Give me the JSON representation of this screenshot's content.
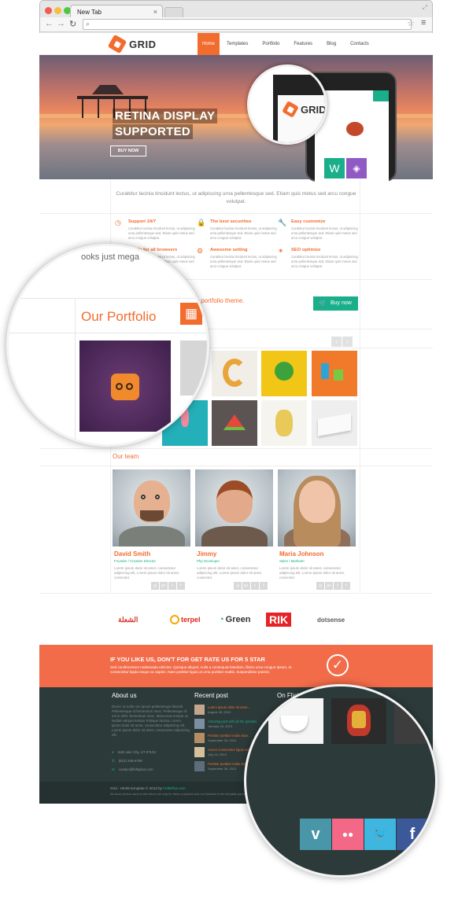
{
  "browser": {
    "tab_label": "New Tab",
    "tab_close": "×",
    "back_icon": "arrow-left-icon",
    "forward_icon": "arrow-right-icon",
    "reload_icon": "reload-icon",
    "search_icon": "search-icon",
    "star_icon": "star-icon",
    "menu_icon": "hamburger-menu-icon",
    "window_buttons": [
      "#ee5c54",
      "#f4be3f",
      "#4ec83e"
    ]
  },
  "nav": {
    "logo_text": "GRID",
    "items": [
      "Home",
      "Templates",
      "Portfolio",
      "Features",
      "Blog",
      "Contacts"
    ],
    "active": "Home"
  },
  "hero": {
    "title_line1": "RETINA DISPLAY",
    "title_line2": "SUPPORTED",
    "button": "BUY NOW"
  },
  "intro": {
    "text": "Curabitur lacinia tincidunt lectus, ut adipiscing urna pellentesque sed. Etiam quis metus sed arcu congue volutpat."
  },
  "features": [
    {
      "title": "Support 24/7",
      "icon": "clock-icon",
      "desc": "Curabitur lacinia tincidunt lectus, ut adipiscing urna pellentesque sed. Etiam quis metus sed arcu congue volutpat."
    },
    {
      "title": "The best securities",
      "icon": "lock-icon",
      "desc": "Curabitur lacinia tincidunt lectus, ut adipiscing urna pellentesque sed. Etiam quis metus sed arcu congue volutpat."
    },
    {
      "title": "Easy customize",
      "icon": "wrench-icon",
      "desc": "Curabitur lacinia tincidunt lectus, ut adipiscing urna pellentesque sed. Etiam quis metus sed arcu congue volutpat."
    },
    {
      "title": "Ready for all browsers",
      "icon": "thumbs-up-icon",
      "desc": "Curabitur lacinia tincidunt lectus, ut adipiscing urna pellentesque sed. Etiam quis metus sed arcu congue volutpat."
    },
    {
      "title": "Awesome setting",
      "icon": "gear-icon",
      "desc": "Curabitur lacinia tincidunt lectus, ut adipiscing urna pellentesque sed. Etiam quis metus sed arcu congue volutpat."
    },
    {
      "title": "SEO optimize",
      "icon": "magic-wand-icon",
      "desc": "Curabitur lacinia tincidunt lectus, ut adipiscing urna pellentesque sed. Etiam quis metus sed arcu congue volutpat."
    }
  ],
  "cta": {
    "left_fragment": "ooks just mega",
    "text": "reative portfolio theme.",
    "button": "Buy now",
    "cart_icon": "cart-icon"
  },
  "portfolio": {
    "title": "Our Portfolio",
    "grid_icon": "grid-icon",
    "prev": "‹",
    "next": "›"
  },
  "team": {
    "title": "Our team",
    "members": [
      {
        "name": "David Smith",
        "role": "Founder / Creative Director",
        "desc": "Lorem ipsum dolor sit amet, consectetur adipiscing elit. Lorem ipsum dolor sit amet, consectet."
      },
      {
        "name": "Jimmy",
        "role": "Php Developer",
        "desc": "Lorem ipsum dolor sit amet, consectetur adipiscing elit. Lorem ipsum dolor sit amet, consectet."
      },
      {
        "name": "Maria Johnson",
        "role": "Sales / Marketer",
        "desc": "Lorem ipsum dolor sit amet, consectetur adipiscing elit. Lorem ipsum dolor sit amet, consectet."
      }
    ],
    "social_icons": [
      "dribbble-icon",
      "google-plus-icon",
      "twitter-icon",
      "facebook-icon"
    ],
    "social_glyphs": [
      "◎",
      "g+",
      "t",
      "f"
    ]
  },
  "clients": [
    "Green",
    "RIK",
    "terpel",
    "dotsense",
    "الشعلة"
  ],
  "rate": {
    "title": "IF YOU LIKE US, DON'T FOR GET RATE US FOR 5 STAR",
    "desc": "Sed condimentum malesuada ultricies. Quisque aliquet, nulla a consequat interdum, libero urna congue ipsum, et consectetur ligula neque ac sapien. Nam porttitor ligula at urna porttitor mattis. Suspendisse potenti.",
    "check_icon": "check-circle-icon"
  },
  "footer": {
    "about_title": "About us",
    "about_text": "Donec ut nulla non ipsum pellentesque blandit. Pellentesque id fermentum nunc. Pellentesque id est in nibh, fermentum nunc. Maecenas tempor ut. Nullam aliquet tempor tristique lacinia. Lorem ipsum dolor sit amet, consectetur adipiscing elit. Lorem ipsum dolor sit amet, consectetur adipiscing elit.",
    "address": "Salt Lake City, UT 87104",
    "phone": "(812) 345-6789",
    "email": "contact@fellsplus.com",
    "recent_title": "Recent post",
    "posts": [
      {
        "title": "Lorem ipsum dolor sit amet...",
        "date": "August 26, 2013"
      },
      {
        "title": "Amazing post with all the goodies",
        "date": "January 18, 2013"
      },
      {
        "title": "Porttitor porttitor malis vitae ...",
        "date": "September 26, 2013"
      },
      {
        "title": "Auctor consectetur ligula nec...",
        "date": "July 24, 2013"
      },
      {
        "title": "Porttitor porttitor malis vitae...",
        "date": "September 26, 2013"
      }
    ],
    "flickr_title": "On Flickr",
    "social": [
      {
        "icon": "vimeo-icon",
        "glyph": "v",
        "color": "#4996a9"
      },
      {
        "icon": "flickr-icon",
        "glyph": "●●",
        "color": "#f36787"
      },
      {
        "icon": "twitter-icon",
        "glyph": "🐦",
        "color": "#3fb6e0"
      },
      {
        "icon": "facebook-icon",
        "glyph": "f",
        "color": "#3b5998"
      }
    ],
    "copyright_prefix": "Grid - Html5 template © 2013 by ",
    "copyright_link": "FellsPlus.com",
    "disclaimer": "All stock photos used on this demo are only for demo purposes and not included in the template package."
  }
}
